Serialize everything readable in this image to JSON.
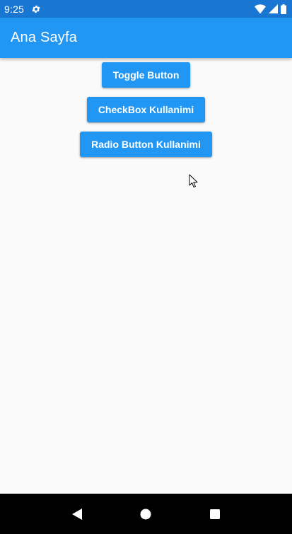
{
  "status_bar": {
    "time": "9:25",
    "icons": [
      "gear-icon",
      "wifi-icon",
      "signal-icon",
      "battery-icon"
    ]
  },
  "app_bar": {
    "title": "Ana Sayfa"
  },
  "buttons": [
    {
      "label": "Toggle Button"
    },
    {
      "label": "CheckBox Kullanimi"
    },
    {
      "label": "Radio Button Kullanimi"
    }
  ],
  "nav_bar": {
    "icons": [
      "back-icon",
      "home-icon",
      "recents-icon"
    ]
  },
  "colors": {
    "status_bar": "#1976d2",
    "primary": "#2196f3",
    "background": "#fafafa",
    "nav_bar": "#000000"
  }
}
